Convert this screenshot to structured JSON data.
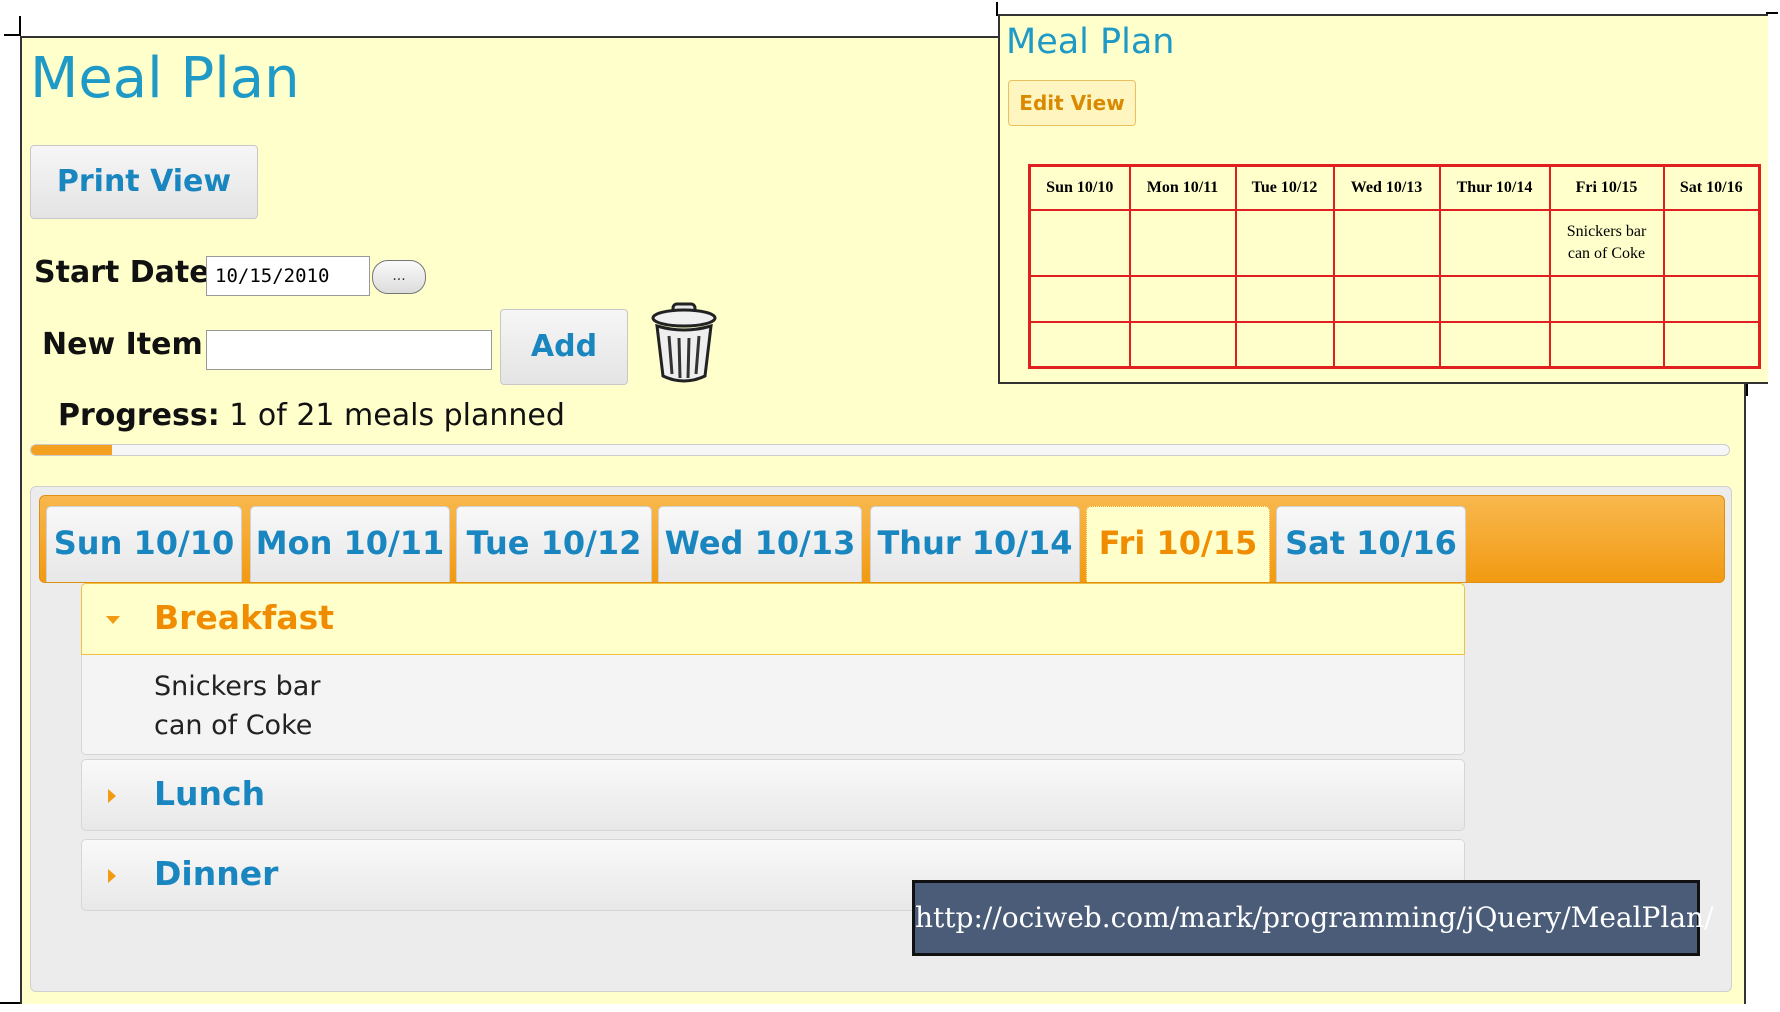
{
  "main": {
    "title": "Meal Plan",
    "print_view_label": "Print View",
    "start_date_label": "Start Date:",
    "start_date_value": "10/15/2010",
    "date_picker_label": "...",
    "new_item_label": "New Item:",
    "new_item_value": "",
    "add_label": "Add",
    "progress_label": "Progress:",
    "progress_text": "1 of 21 meals planned",
    "progress_fraction": 0.0476
  },
  "tabs": [
    "Sun 10/10",
    "Mon 10/11",
    "Tue 10/12",
    "Wed 10/13",
    "Thur 10/14",
    "Fri 10/15",
    "Sat 10/16"
  ],
  "active_tab": "Fri 10/15",
  "accordion": {
    "breakfast": "Breakfast",
    "breakfast_items": [
      "Snickers bar",
      "can of Coke"
    ],
    "lunch": "Lunch",
    "dinner": "Dinner"
  },
  "url": "http://ociweb.com/mark/programming/jQuery/MealPlan/",
  "print_view": {
    "title": "Meal Plan",
    "edit_view_label": "Edit View",
    "days": [
      "Sun 10/10",
      "Mon 10/11",
      "Tue 10/12",
      "Wed 10/13",
      "Thur 10/14",
      "Fri 10/15",
      "Sat 10/16"
    ],
    "friday_breakfast": [
      "Snickers bar",
      "can of Coke"
    ]
  },
  "colors": {
    "title_blue": "#1f9ac7",
    "tab_orange": "#f29a12",
    "background_yellow": "#ffffcc",
    "table_red": "#e02020"
  },
  "icons": [
    "trash-can-icon",
    "collapse-arrow-icon",
    "expand-arrow-icon"
  ]
}
